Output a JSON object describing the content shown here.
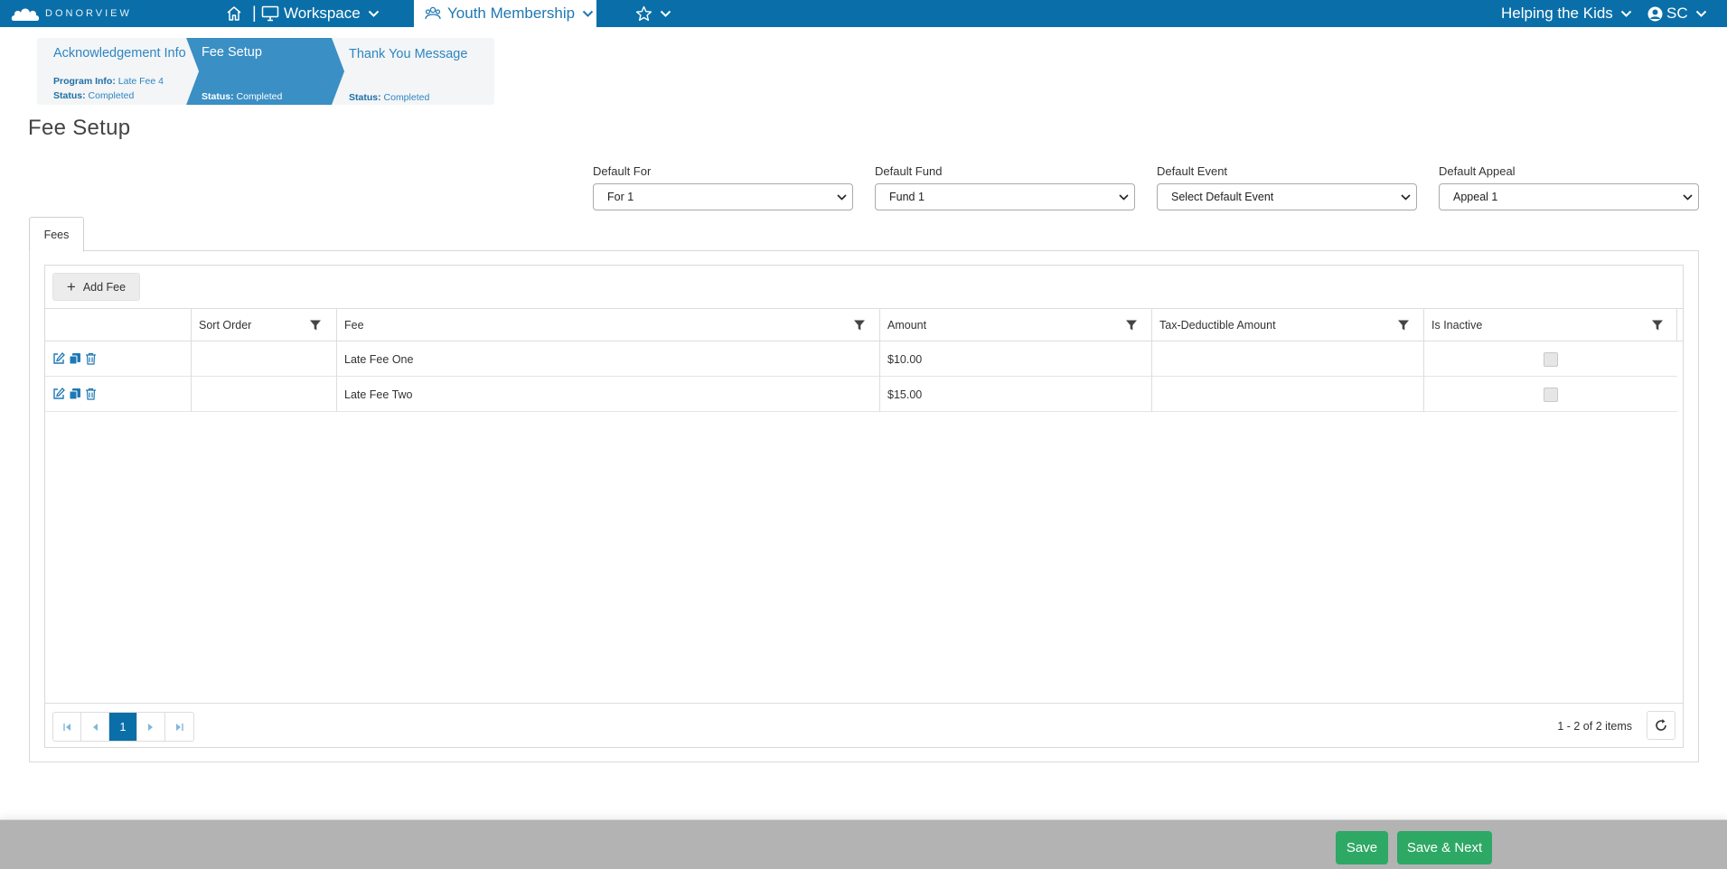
{
  "app": {
    "logo_text": "DONORVIEW"
  },
  "nav": {
    "workspace_label": "Workspace",
    "active_section_label": "Youth Membership",
    "organization_label": "Helping the Kids",
    "user_initials": "SC",
    "icons": [
      "home-icon",
      "monitor-icon",
      "group-icon",
      "star-icon",
      "user-circle-icon",
      "chevron-down-icon"
    ]
  },
  "wizard": {
    "steps": [
      {
        "title": "Acknowledgement Info",
        "program_info_label": "Program Info:",
        "program_info_value": "Late Fee 4",
        "status_label": "Status:",
        "status_value": "Completed",
        "active": false
      },
      {
        "title": "Fee Setup",
        "status_label": "Status:",
        "status_value": "Completed",
        "active": true
      },
      {
        "title": "Thank You Message",
        "status_label": "Status:",
        "status_value": "Completed",
        "active": false
      }
    ]
  },
  "page": {
    "title": "Fee Setup"
  },
  "defaults": [
    {
      "label": "Default For",
      "value": "For 1"
    },
    {
      "label": "Default Fund",
      "value": "Fund 1"
    },
    {
      "label": "Default Event",
      "value": "Select Default Event"
    },
    {
      "label": "Default Appeal",
      "value": "Appeal 1"
    }
  ],
  "tabs": [
    {
      "label": "Fees",
      "active": true
    }
  ],
  "grid": {
    "add_button_label": "Add Fee",
    "columns": [
      "Sort Order",
      "Fee",
      "Amount",
      "Tax-Deductible Amount",
      "Is Inactive"
    ],
    "rows": [
      {
        "sort_order": "",
        "fee": "Late Fee One",
        "amount": "$10.00",
        "tax_deductible": "",
        "is_inactive": false
      },
      {
        "sort_order": "",
        "fee": "Late Fee Two",
        "amount": "$15.00",
        "tax_deductible": "",
        "is_inactive": false
      }
    ],
    "pager": {
      "current_page": "1",
      "info": "1 - 2 of 2 items"
    }
  },
  "footer": {
    "save_label": "Save",
    "save_next_label": "Save & Next"
  },
  "colors": {
    "nav_blue": "#0a6fa8",
    "link_blue": "#2e86c1",
    "active_step": "#3a8fc4",
    "button_green": "#2ea865",
    "footer_gray": "#b3b3b3"
  }
}
